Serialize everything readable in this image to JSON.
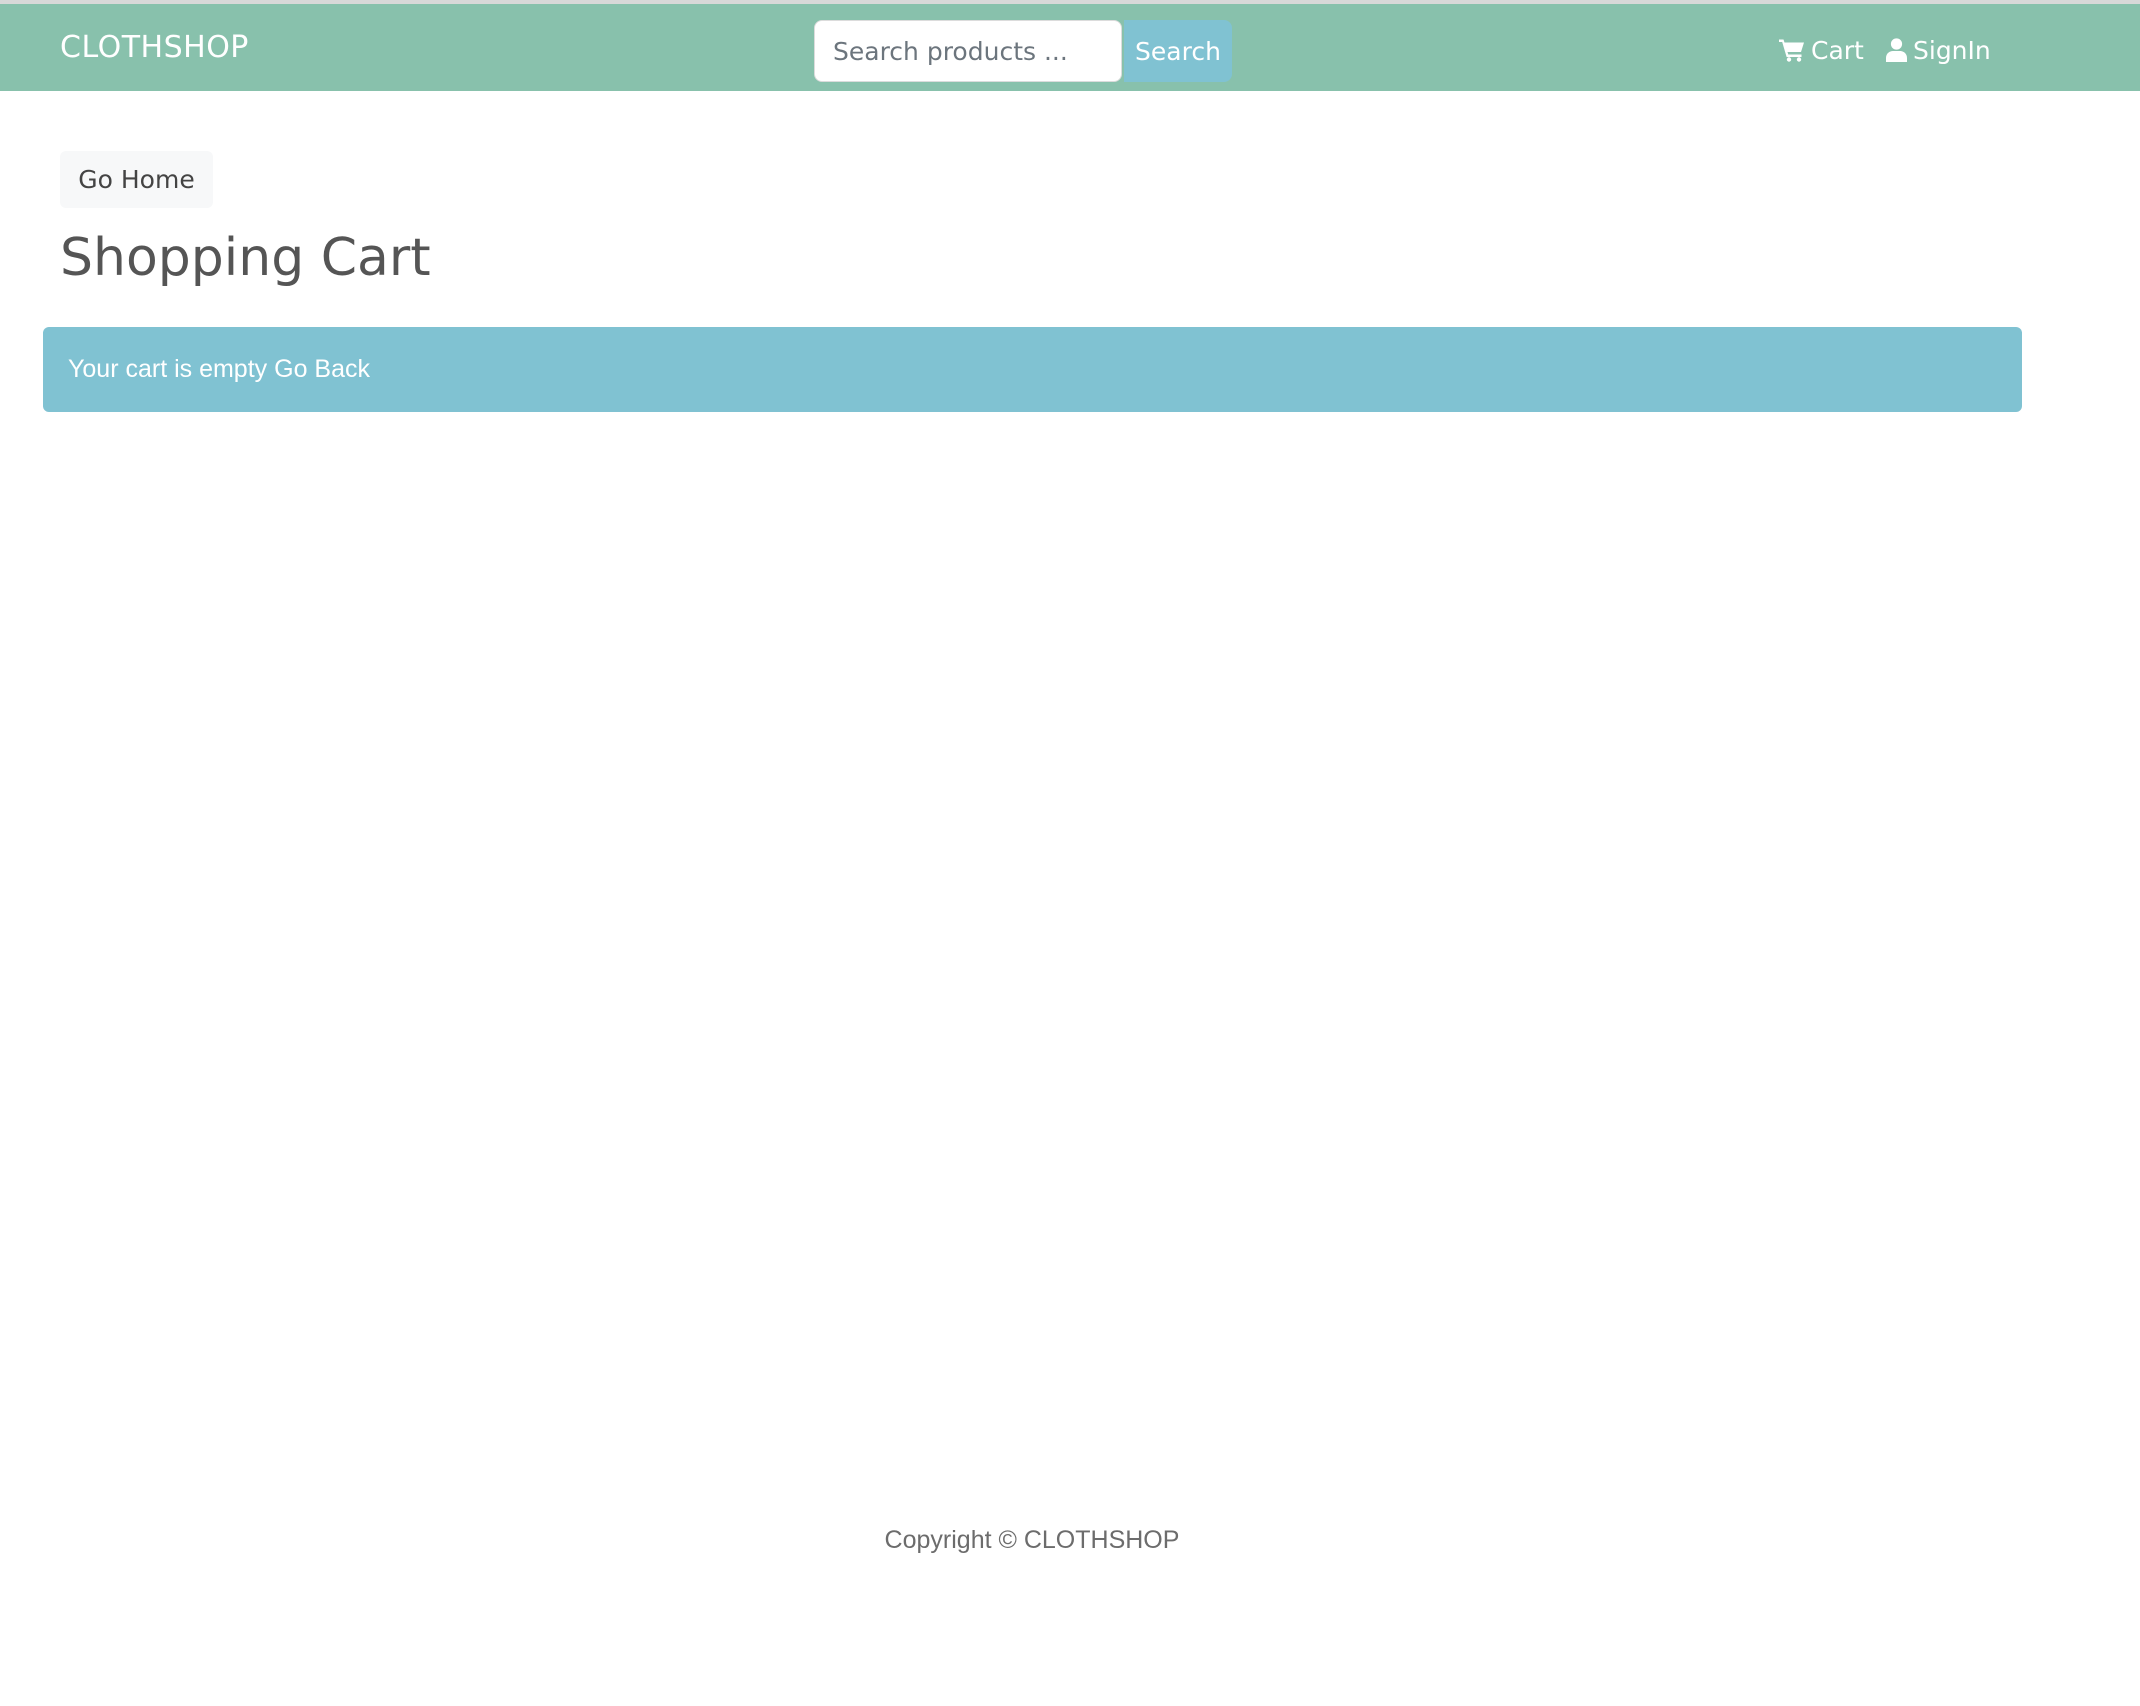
{
  "header": {
    "brand": "CLOTHSHOP",
    "search": {
      "placeholder": "Search products ...",
      "button_label": "Search"
    },
    "nav": {
      "cart_label": "Cart",
      "cart_icon": "shopping-cart-icon",
      "signin_label": "SignIn",
      "signin_icon": "user-icon"
    },
    "colors": {
      "navbar_bg": "#88c1ac",
      "accent": "#80c2d2"
    }
  },
  "main": {
    "go_home_label": "Go Home",
    "title": "Shopping Cart",
    "alert": {
      "message": "Your cart is empty",
      "link_label": "Go Back"
    }
  },
  "footer": {
    "copyright": "Copyright © CLOTHSHOP"
  }
}
